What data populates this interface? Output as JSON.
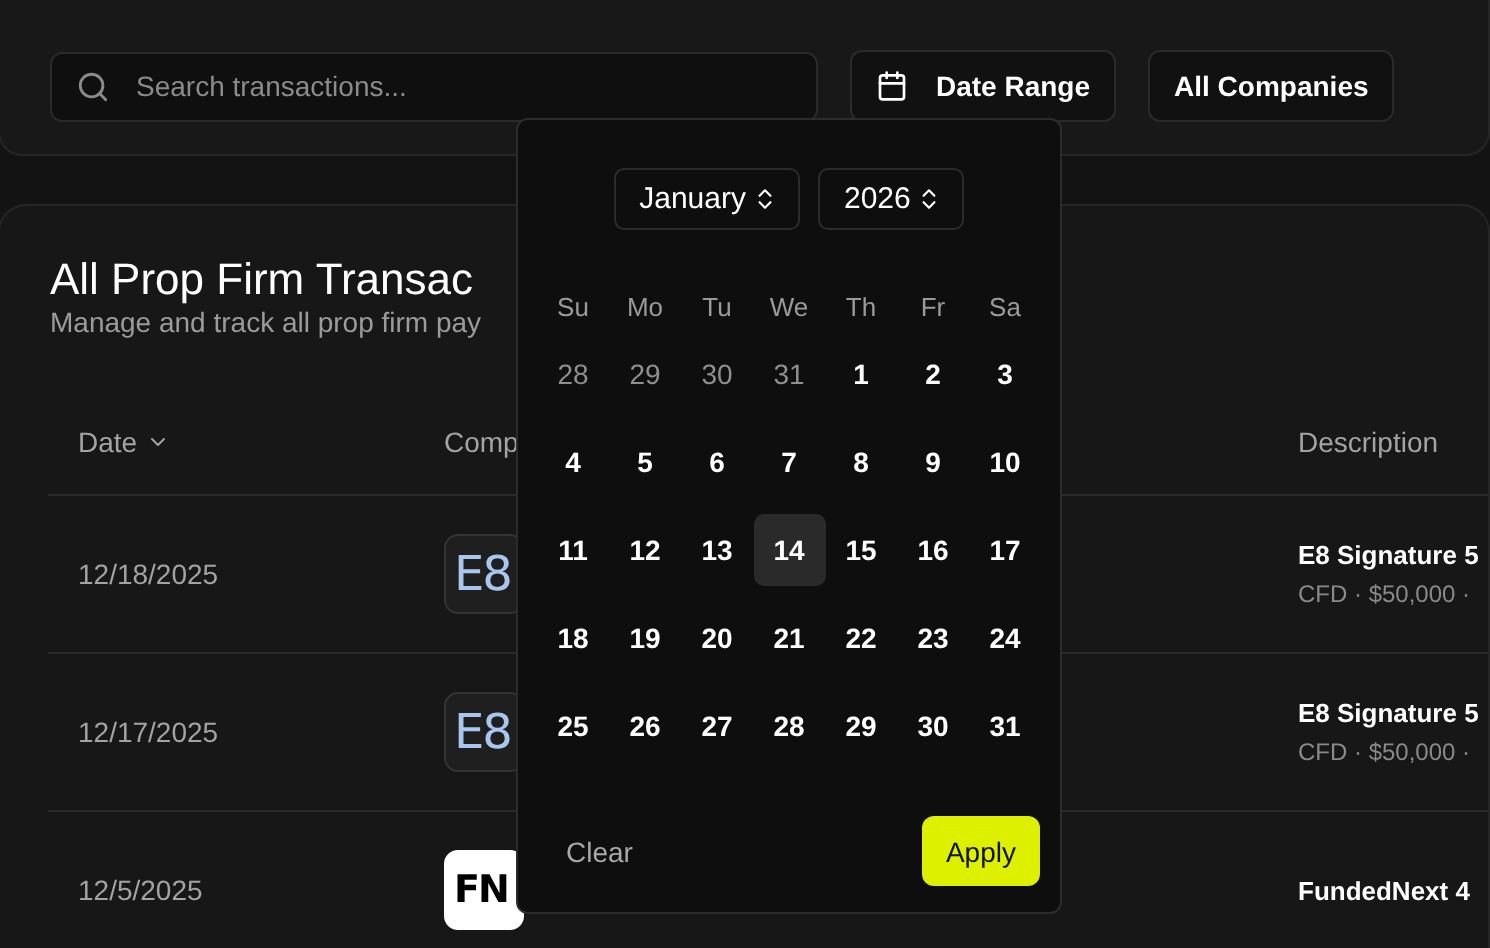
{
  "toolbar": {
    "search": {
      "placeholder": "Search transactions..."
    },
    "date_range": {
      "label": "Date Range"
    },
    "company_filter": {
      "label": "All Companies"
    }
  },
  "transactions": {
    "title": "All Prop Firm Transac",
    "subtitle": "Manage and track all prop firm pay",
    "columns": [
      {
        "label": "Date",
        "sorted": true
      },
      {
        "label": "Comp"
      },
      {
        "label": "Description"
      }
    ],
    "rows": [
      {
        "date": "12/18/2025",
        "logo": "E8",
        "kind": "gradient",
        "title": "E8 Signature 5",
        "details": "CFD · $50,000 ·"
      },
      {
        "date": "12/17/2025",
        "logo": "E8",
        "kind": "gradient",
        "title": "E8 Signature 5",
        "details": "CFD · $50,000 ·"
      },
      {
        "date": "12/5/2025",
        "logo": "FN",
        "kind": "light",
        "title": "FundedNext 4"
      }
    ]
  },
  "calendar": {
    "month": "January",
    "year": "2026",
    "weekdays": [
      "Su",
      "Mo",
      "Tu",
      "We",
      "Th",
      "Fr",
      "Sa"
    ],
    "weeks": [
      [
        {
          "label": "28",
          "outside": true,
          "selected": false
        },
        {
          "label": "29",
          "outside": true,
          "selected": false
        },
        {
          "label": "30",
          "outside": true,
          "selected": false
        },
        {
          "label": "31",
          "outside": true,
          "selected": false
        },
        {
          "label": "1",
          "outside": false,
          "selected": false
        },
        {
          "label": "2",
          "outside": false,
          "selected": false
        },
        {
          "label": "3",
          "outside": false,
          "selected": false
        }
      ],
      [
        {
          "label": "4",
          "outside": false,
          "selected": false
        },
        {
          "label": "5",
          "outside": false,
          "selected": false
        },
        {
          "label": "6",
          "outside": false,
          "selected": false
        },
        {
          "label": "7",
          "outside": false,
          "selected": false
        },
        {
          "label": "8",
          "outside": false,
          "selected": false
        },
        {
          "label": "9",
          "outside": false,
          "selected": false
        },
        {
          "label": "10",
          "outside": false,
          "selected": false
        }
      ],
      [
        {
          "label": "11",
          "outside": false,
          "selected": false
        },
        {
          "label": "12",
          "outside": false,
          "selected": false
        },
        {
          "label": "13",
          "outside": false,
          "selected": false
        },
        {
          "label": "14",
          "outside": false,
          "selected": true
        },
        {
          "label": "15",
          "outside": false,
          "selected": false
        },
        {
          "label": "16",
          "outside": false,
          "selected": false
        },
        {
          "label": "17",
          "outside": false,
          "selected": false
        }
      ],
      [
        {
          "label": "18",
          "outside": false,
          "selected": false
        },
        {
          "label": "19",
          "outside": false,
          "selected": false
        },
        {
          "label": "20",
          "outside": false,
          "selected": false
        },
        {
          "label": "21",
          "outside": false,
          "selected": false
        },
        {
          "label": "22",
          "outside": false,
          "selected": false
        },
        {
          "label": "23",
          "outside": false,
          "selected": false
        },
        {
          "label": "24",
          "outside": false,
          "selected": false
        }
      ],
      [
        {
          "label": "25",
          "outside": false,
          "selected": false
        },
        {
          "label": "26",
          "outside": false,
          "selected": false
        },
        {
          "label": "27",
          "outside": false,
          "selected": false
        },
        {
          "label": "28",
          "outside": false,
          "selected": false
        },
        {
          "label": "29",
          "outside": false,
          "selected": false
        },
        {
          "label": "30",
          "outside": false,
          "selected": false
        },
        {
          "label": "31",
          "outside": false,
          "selected": false
        }
      ]
    ],
    "clear": "Clear",
    "apply": "Apply"
  }
}
